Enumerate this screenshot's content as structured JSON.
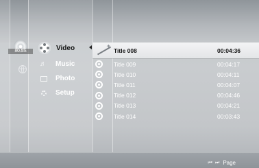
{
  "disc": {
    "label": "80.5S",
    "icon": "disc-icon"
  },
  "menu": {
    "items": [
      {
        "label": "Video",
        "icon": "film-reel-icon",
        "active": true
      },
      {
        "label": "Music",
        "icon": "music-note-icon",
        "active": false
      },
      {
        "label": "Photo",
        "icon": "photo-icon",
        "active": false
      },
      {
        "label": "Setup",
        "icon": "gear-icon",
        "active": false
      }
    ]
  },
  "titles": [
    {
      "name": "Title 008",
      "time": "00:04:36",
      "selected": true
    },
    {
      "name": "Title 009",
      "time": "00:04:17",
      "selected": false
    },
    {
      "name": "Title 010",
      "time": "00:04:11",
      "selected": false
    },
    {
      "name": "Title 011",
      "time": "00:04:07",
      "selected": false
    },
    {
      "name": "Title 012",
      "time": "00:04:46",
      "selected": false
    },
    {
      "name": "Title 013",
      "time": "00:04:21",
      "selected": false
    },
    {
      "name": "Title 014",
      "time": "00:03:43",
      "selected": false
    }
  ],
  "footer": {
    "skip_icon": "⏮ ⏭",
    "page_label": "Page"
  },
  "colors": {
    "highlight": "#eeeff1",
    "text": "#ffffff",
    "selected_text": "#111111"
  }
}
